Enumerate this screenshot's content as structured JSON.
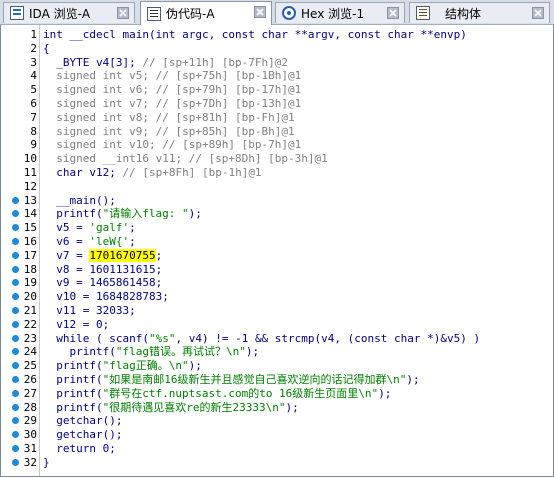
{
  "tabs": [
    {
      "label": "IDA 浏览-A",
      "icon": "ida-view-icon",
      "active": false
    },
    {
      "label": "伪代码-A",
      "icon": "pseudocode-icon",
      "active": true
    },
    {
      "label": "Hex 浏览-1",
      "icon": "hex-view-icon",
      "active": false
    },
    {
      "label": "结构体",
      "icon": "structures-icon",
      "active": false
    }
  ],
  "code_lines": [
    {
      "n": "1",
      "dot": false,
      "t": [
        [
          "k",
          "int __cdecl main(int argc, const char **argv, const char **envp)"
        ]
      ]
    },
    {
      "n": "2",
      "dot": false,
      "t": [
        [
          "k",
          "{"
        ]
      ]
    },
    {
      "n": "3",
      "dot": false,
      "t": [
        [
          "k",
          "  _BYTE v4[3]; "
        ],
        [
          "c",
          "// [sp+11h] [bp-7Fh]@2"
        ]
      ]
    },
    {
      "n": "4",
      "dot": false,
      "t": [
        [
          "c",
          "  signed int v5; // [sp+75h] [bp-1Bh]@1"
        ]
      ]
    },
    {
      "n": "5",
      "dot": false,
      "t": [
        [
          "c",
          "  signed int v6; // [sp+79h] [bp-17h]@1"
        ]
      ]
    },
    {
      "n": "6",
      "dot": false,
      "t": [
        [
          "c",
          "  signed int v7; // [sp+7Dh] [bp-13h]@1"
        ]
      ]
    },
    {
      "n": "7",
      "dot": false,
      "t": [
        [
          "c",
          "  signed int v8; // [sp+81h] [bp-Fh]@1"
        ]
      ]
    },
    {
      "n": "8",
      "dot": false,
      "t": [
        [
          "c",
          "  signed int v9; // [sp+85h] [bp-Bh]@1"
        ]
      ]
    },
    {
      "n": "9",
      "dot": false,
      "t": [
        [
          "c",
          "  signed int v10; // [sp+89h] [bp-7h]@1"
        ]
      ]
    },
    {
      "n": "10",
      "dot": false,
      "t": [
        [
          "c",
          "  signed __int16 v11; // [sp+8Dh] [bp-3h]@1"
        ]
      ]
    },
    {
      "n": "11",
      "dot": false,
      "t": [
        [
          "k",
          "  char v12; "
        ],
        [
          "c",
          "// [sp+8Fh] [bp-1h]@1"
        ]
      ]
    },
    {
      "n": "12",
      "dot": false,
      "t": [
        [
          "k",
          ""
        ]
      ]
    },
    {
      "n": "13",
      "dot": true,
      "t": [
        [
          "k",
          "  __main();"
        ]
      ]
    },
    {
      "n": "14",
      "dot": true,
      "t": [
        [
          "k",
          "  printf("
        ],
        [
          "s",
          "\"请输入flag: \""
        ],
        [
          "k",
          ");"
        ]
      ]
    },
    {
      "n": "15",
      "dot": true,
      "t": [
        [
          "k",
          "  v5 = "
        ],
        [
          "s",
          "'galf'"
        ],
        [
          "k",
          ";"
        ]
      ]
    },
    {
      "n": "16",
      "dot": true,
      "t": [
        [
          "k",
          "  v6 = "
        ],
        [
          "s",
          "'leW{'"
        ],
        [
          "k",
          ";"
        ]
      ]
    },
    {
      "n": "17",
      "dot": true,
      "t": [
        [
          "k",
          "  v7 = "
        ],
        [
          "h",
          "1701670755"
        ],
        [
          "k",
          ";"
        ]
      ]
    },
    {
      "n": "18",
      "dot": true,
      "t": [
        [
          "k",
          "  v8 = 1601131615;"
        ]
      ]
    },
    {
      "n": "19",
      "dot": true,
      "t": [
        [
          "k",
          "  v9 = 1465861458;"
        ]
      ]
    },
    {
      "n": "20",
      "dot": true,
      "t": [
        [
          "k",
          "  v10 = 1684828783;"
        ]
      ]
    },
    {
      "n": "21",
      "dot": true,
      "t": [
        [
          "k",
          "  v11 = 32033;"
        ]
      ]
    },
    {
      "n": "22",
      "dot": true,
      "t": [
        [
          "k",
          "  v12 = 0;"
        ]
      ]
    },
    {
      "n": "23",
      "dot": true,
      "t": [
        [
          "k",
          "  while ( scanf("
        ],
        [
          "s",
          "\"%s\""
        ],
        [
          "k",
          ", v4) != -1 && strcmp(v4, (const char *)&v5) )"
        ]
      ]
    },
    {
      "n": "24",
      "dot": true,
      "t": [
        [
          "k",
          "    printf("
        ],
        [
          "s",
          "\"flag错误。再试试？\\n\""
        ],
        [
          "k",
          ");"
        ]
      ]
    },
    {
      "n": "25",
      "dot": true,
      "t": [
        [
          "k",
          "  printf("
        ],
        [
          "s",
          "\"flag正确。\\n\""
        ],
        [
          "k",
          ");"
        ]
      ]
    },
    {
      "n": "26",
      "dot": true,
      "t": [
        [
          "k",
          "  printf("
        ],
        [
          "s",
          "\"如果是南邮16级新生并且感觉自己喜欢逆向的话记得加群\\n\""
        ],
        [
          "k",
          ");"
        ]
      ]
    },
    {
      "n": "27",
      "dot": true,
      "t": [
        [
          "k",
          "  printf("
        ],
        [
          "s",
          "\"群号在ctf.nuptsast.com的to 16级新生页面里\\n\""
        ],
        [
          "k",
          ");"
        ]
      ]
    },
    {
      "n": "28",
      "dot": true,
      "t": [
        [
          "k",
          "  printf("
        ],
        [
          "s",
          "\"很期待遇见喜欢re的新生23333\\n\""
        ],
        [
          "k",
          ");"
        ]
      ]
    },
    {
      "n": "29",
      "dot": true,
      "t": [
        [
          "k",
          "  getchar();"
        ]
      ]
    },
    {
      "n": "30",
      "dot": true,
      "t": [
        [
          "k",
          "  getchar();"
        ]
      ]
    },
    {
      "n": "31",
      "dot": true,
      "t": [
        [
          "k",
          "  return 0;"
        ]
      ]
    },
    {
      "n": "32",
      "dot": true,
      "t": [
        [
          "k",
          "}"
        ]
      ]
    }
  ]
}
